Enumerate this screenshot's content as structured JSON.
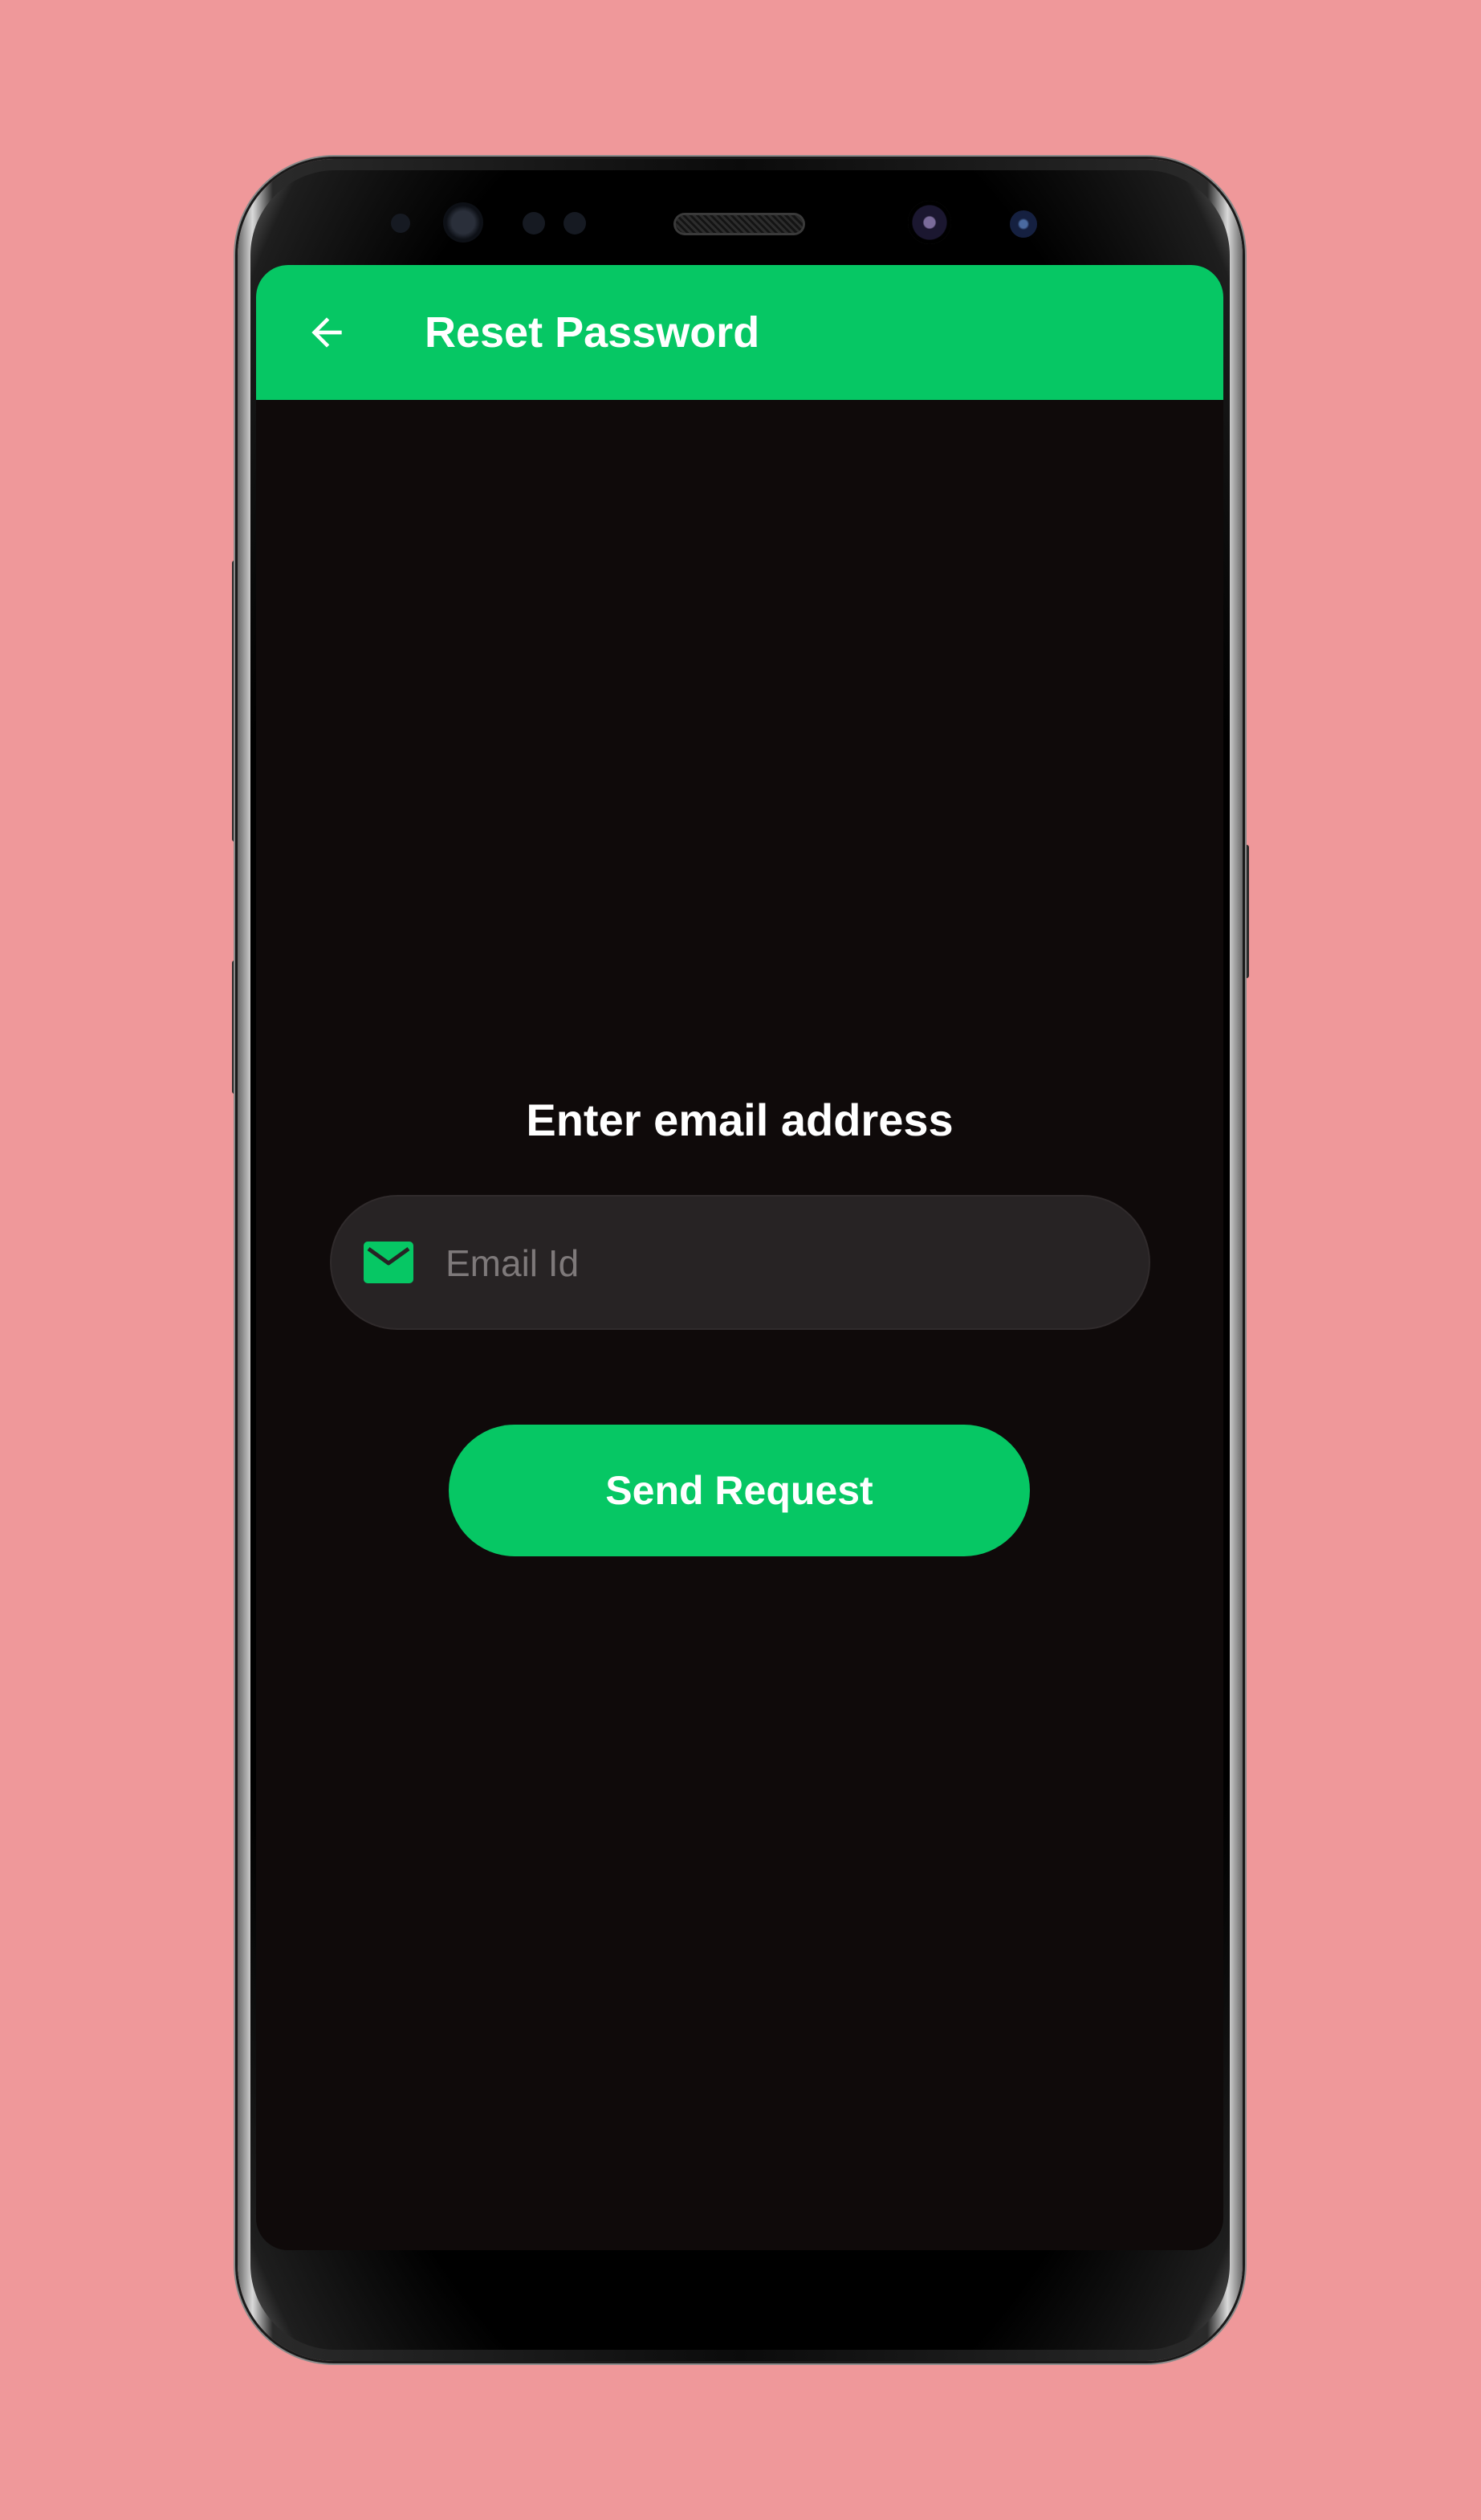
{
  "app_bar": {
    "title": "Reset Password",
    "back_icon": "arrow-left-icon",
    "background": "#06c764"
  },
  "form": {
    "prompt": "Enter email address",
    "email": {
      "icon": "mail-icon",
      "placeholder": "Email Id",
      "value": ""
    },
    "submit_label": "Send Request"
  },
  "colors": {
    "accent": "#06c764",
    "screen_background": "#0f0a0a",
    "field_background": "#272324",
    "page_background": "#ef989a",
    "text": "#ffffff",
    "placeholder": "#7e797a"
  }
}
